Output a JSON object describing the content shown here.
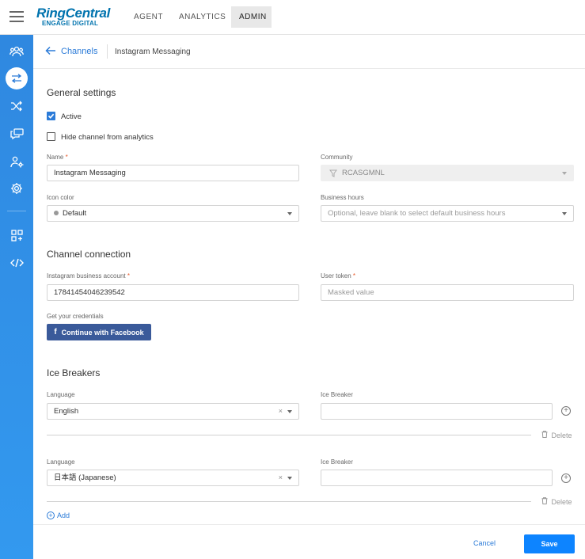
{
  "app": {
    "logo_primary": "RingCentral",
    "logo_secondary": "ENGAGE DIGITAL",
    "nav_tabs": [
      "AGENT",
      "ANALYTICS",
      "ADMIN"
    ],
    "active_tab": "ADMIN"
  },
  "sidebar": {
    "icons": [
      "users-icon",
      "channels-icon",
      "routing-icon",
      "chat-icon",
      "agent-settings-icon",
      "settings-icon",
      "extensions-icon",
      "code-icon"
    ],
    "active": "channels-icon",
    "active_color": "#2b7bd8"
  },
  "breadcrumb": {
    "parent": "Channels",
    "current": "Instagram Messaging"
  },
  "general": {
    "heading": "General settings",
    "active_label": "Active",
    "active_checked": true,
    "hide_label": "Hide channel from analytics",
    "hide_checked": false,
    "name_label": "Name",
    "name_value": "Instagram Messaging",
    "community_label": "Community",
    "community_value": "RCASGMNL",
    "icon_color_label": "Icon color",
    "icon_color_value": "Default",
    "business_hours_label": "Business hours",
    "business_hours_placeholder": "Optional, leave blank to select default business hours",
    "required_mark": "*"
  },
  "connection": {
    "heading": "Channel connection",
    "account_label": "Instagram business account",
    "account_value": "17841454046239542",
    "token_label": "User token",
    "token_placeholder": "Masked value",
    "credentials_label": "Get your credentials",
    "facebook_button": "Continue with Facebook",
    "facebook_glyph": "f",
    "facebook_color": "#3a5a9a"
  },
  "ice_breakers": {
    "heading": "Ice Breakers",
    "items": [
      {
        "language_label": "Language",
        "language_value": "English",
        "breaker_label": "Ice Breaker",
        "breaker_value": "",
        "delete_label": "Delete"
      },
      {
        "language_label": "Language",
        "language_value": "日本語 (Japanese)",
        "breaker_label": "Ice Breaker",
        "breaker_value": "",
        "delete_label": "Delete"
      }
    ],
    "add_label": "Add",
    "clear_glyph": "×",
    "plus_glyph": "+"
  },
  "footer": {
    "cancel_label": "Cancel",
    "save_label": "Save",
    "save_color": "#0d84ff"
  }
}
